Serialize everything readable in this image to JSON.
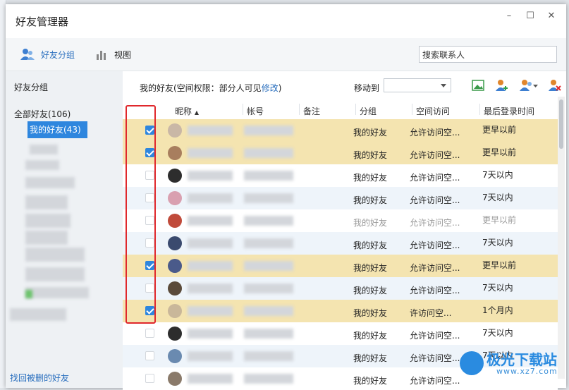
{
  "window": {
    "title": "好友管理器",
    "controls": [
      "minimize-icon",
      "maximize-icon",
      "close-icon"
    ]
  },
  "toolbar": {
    "friend_group_label": "好友分组",
    "view_label": "视图",
    "search_placeholder": "搜索联系人"
  },
  "sidebar": {
    "header": "好友分组",
    "root_label": "全部好友(106)",
    "selected_group": "我的好友(43)",
    "footer_link": "找回被删的好友"
  },
  "main": {
    "header_prefix": "我的好友(空间权限：部分人可见",
    "header_link": "修改",
    "header_suffix": ")",
    "move_to_label": "移动到",
    "move_to_value": "",
    "actions": [
      "friend-image-icon",
      "add-friend-icon",
      "friend-dropdown-icon",
      "delete-friend-icon"
    ]
  },
  "table": {
    "columns": [
      "昵称",
      "帐号",
      "备注",
      "分组",
      "空间访问",
      "最后登录时间"
    ],
    "rows": [
      {
        "checked": true,
        "group": "我的好友",
        "access": "允许访问空...",
        "last_login": "更早以前",
        "style": "sel"
      },
      {
        "checked": true,
        "group": "我的好友",
        "access": "允许访问空...",
        "last_login": "更早以前",
        "style": "sel"
      },
      {
        "checked": false,
        "group": "我的好友",
        "access": "允许访问空...",
        "last_login": "7天以内",
        "style": "alt"
      },
      {
        "checked": false,
        "group": "我的好友",
        "access": "允许访问空...",
        "last_login": "7天以内",
        "style": "tint"
      },
      {
        "checked": false,
        "group": "我的好友",
        "access": "允许访问空...",
        "last_login": "更早以前",
        "style": "alt",
        "dim": true
      },
      {
        "checked": false,
        "group": "我的好友",
        "access": "允许访问空...",
        "last_login": "7天以内",
        "style": "tint"
      },
      {
        "checked": true,
        "group": "我的好友",
        "access": "允许访问空...",
        "last_login": "更早以前",
        "style": "sel"
      },
      {
        "checked": false,
        "group": "我的好友",
        "access": "允许访问空...",
        "last_login": "7天以内",
        "style": "tint"
      },
      {
        "checked": true,
        "group": "我的好友",
        "access": "许访问空...",
        "last_login": "1个月内",
        "style": "sel"
      },
      {
        "checked": false,
        "group": "我的好友",
        "access": "允许访问空...",
        "last_login": "7天以内",
        "style": "alt"
      },
      {
        "checked": false,
        "group": "我的好友",
        "access": "允许访问空...",
        "last_login": "7天以内",
        "style": "tint"
      },
      {
        "checked": false,
        "group": "我的好友",
        "access": "允许访问空...",
        "last_login": "",
        "style": "alt"
      }
    ]
  },
  "watermark": {
    "text": "极光下载站",
    "url": "www.xz7.com"
  },
  "colors": {
    "accent": "#2e86de",
    "selected_row": "#f4e4b0",
    "highlight_box": "#e0282c",
    "link": "#2a6fbe"
  }
}
